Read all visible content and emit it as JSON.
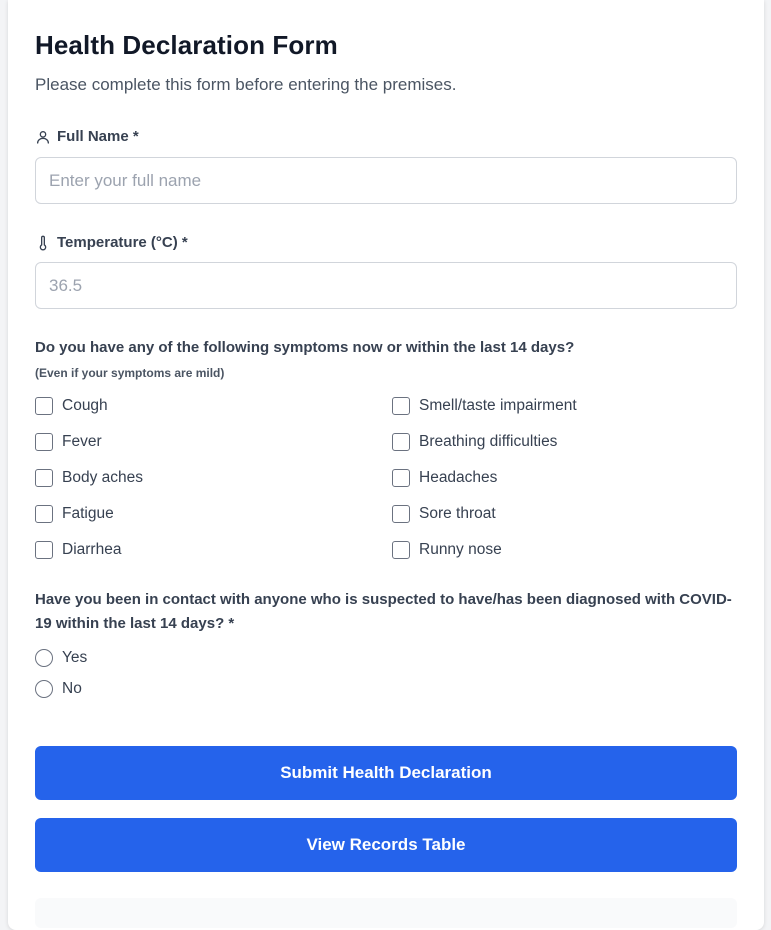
{
  "form": {
    "title": "Health Declaration Form",
    "subtitle": "Please complete this form before entering the premises.",
    "full_name": {
      "label": "Full Name *",
      "icon": "user-icon",
      "placeholder": "Enter your full name",
      "value": ""
    },
    "temperature": {
      "label": "Temperature (°C) *",
      "icon": "thermometer-icon",
      "placeholder": "36.5",
      "value": ""
    },
    "symptoms": {
      "question": "Do you have any of the following symptoms now or within the last 14 days?",
      "hint": "(Even if your symptoms are mild)",
      "options": [
        "Cough",
        "Smell/taste impairment",
        "Fever",
        "Breathing difficulties",
        "Body aches",
        "Headaches",
        "Fatigue",
        "Sore throat",
        "Diarrhea",
        "Runny nose"
      ]
    },
    "contact": {
      "question": "Have you been in contact with anyone who is suspected to have/has been diagnosed with COVID-19 within the last 14 days? *",
      "options": [
        "Yes",
        "No"
      ]
    },
    "submit_label": "Submit Health Declaration",
    "records_label": "View Records Table"
  },
  "colors": {
    "primary": "#2563eb",
    "text": "#374151",
    "title": "#111827",
    "border": "#d1d5db"
  }
}
